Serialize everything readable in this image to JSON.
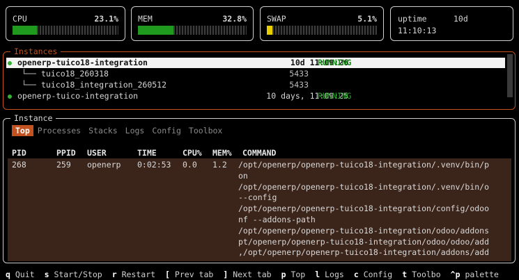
{
  "stats": {
    "cpu": {
      "label": "CPU",
      "value": "23.1%",
      "fill": 0.231,
      "color": "#1f9a1f"
    },
    "mem": {
      "label": "MEM",
      "value": "32.8%",
      "fill": 0.328,
      "color": "#1f9a1f"
    },
    "swap": {
      "label": "SWAP",
      "value": "5.1%",
      "fill": 0.051,
      "color": "#e8d000"
    },
    "uptime": {
      "label": "uptime",
      "days": "10d",
      "time": "11:10:13"
    }
  },
  "instances": {
    "title": "Instances",
    "rows": [
      {
        "name": "openerp-tuico18-integration",
        "uptime": "10d 11:09:26",
        "status": "RUNNING"
      },
      {
        "name": "openerp-tuico-integration",
        "uptime": "10 days, 11:09:25",
        "status": "RUNNING"
      }
    ],
    "children": [
      {
        "branch": "└──",
        "name": "tuico18_260318",
        "pid": "5433"
      },
      {
        "branch": "└──",
        "name": "tuico18_integration_260512",
        "pid": "5433"
      }
    ]
  },
  "instance": {
    "title": "Instance",
    "tabs": [
      "Top",
      "Processes",
      "Stacks",
      "Logs",
      "Config",
      "Toolbox"
    ],
    "columns": [
      "PID",
      "PPID",
      "USER",
      "TIME",
      "CPU%",
      "MEM%",
      "COMMAND"
    ],
    "row": {
      "pid": "268",
      "ppid": "259",
      "user": "openerp",
      "time": "0:02:53",
      "cpu": "0.0",
      "mem": "1.2",
      "command_lines": [
        "/opt/openerp/openerp-tuico18-integration/.venv/bin/p",
        "on",
        "/opt/openerp/openerp-tuico18-integration/.venv/bin/o",
        "--config",
        "/opt/openerp/openerp-tuico18-integration/config/odoo",
        "nf --addons-path",
        "/opt/openerp/openerp-tuico18-integration/odoo/addons",
        "pt/openerp/openerp-tuico18-integration/odoo/odoo/add",
        ",/opt/openerp/openerp-tuico18-integration/addons/add"
      ]
    }
  },
  "footer": [
    {
      "key": "q",
      "label": "Quit"
    },
    {
      "key": "s",
      "label": "Start/Stop"
    },
    {
      "key": "r",
      "label": "Restart"
    },
    {
      "key": "[",
      "label": "Prev tab"
    },
    {
      "key": "]",
      "label": "Next tab"
    },
    {
      "key": "p",
      "label": "Top"
    },
    {
      "key": "l",
      "label": "Logs"
    },
    {
      "key": "c",
      "label": "Config"
    },
    {
      "key": "t",
      "label": "Toolbo"
    },
    {
      "key": "^p",
      "label": "palette"
    }
  ]
}
